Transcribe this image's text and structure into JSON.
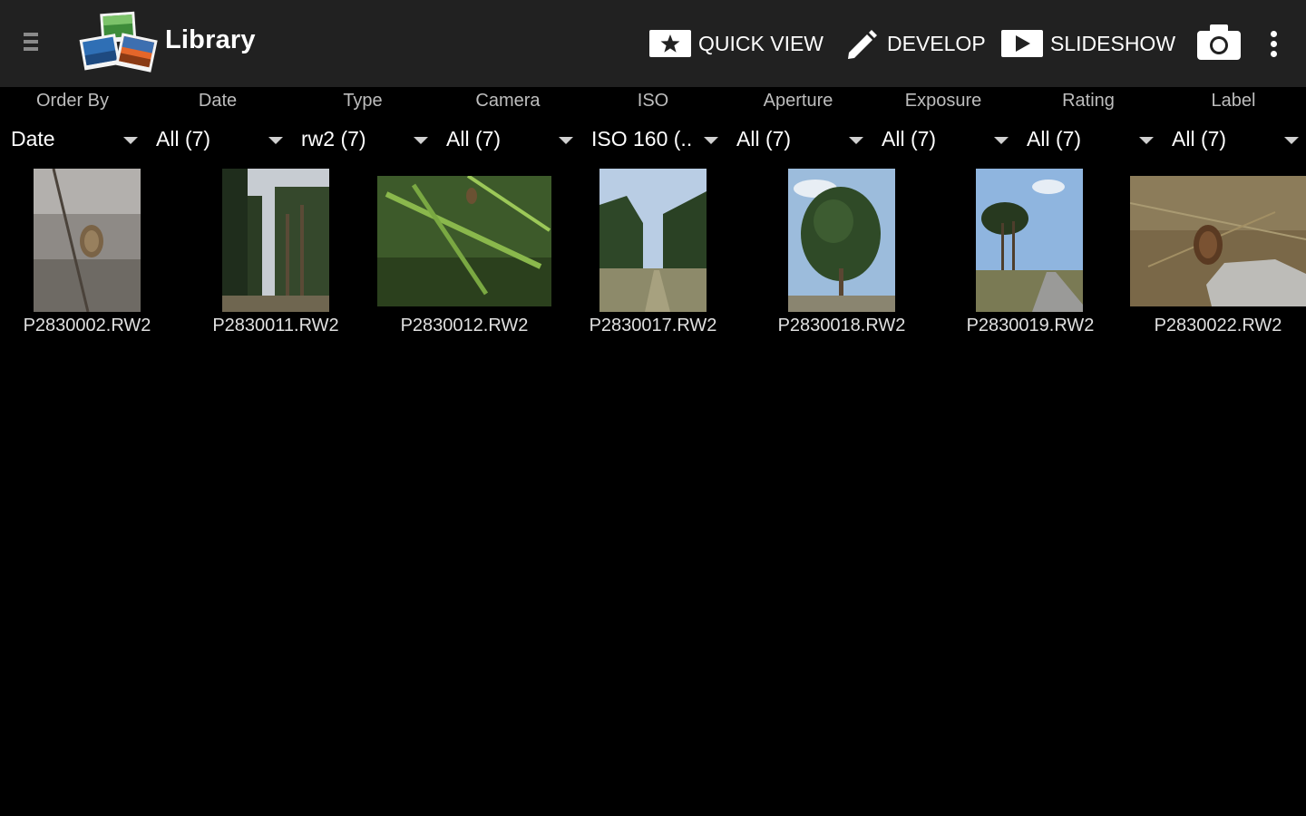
{
  "header": {
    "title": "Library",
    "actions": {
      "quick_view": "QUICK VIEW",
      "develop": "DEVELOP",
      "slideshow": "SLIDESHOW"
    }
  },
  "filters": [
    {
      "label": "Order By",
      "value": "Date"
    },
    {
      "label": "Date",
      "value": "All (7)"
    },
    {
      "label": "Type",
      "value": "rw2 (7)"
    },
    {
      "label": "Camera",
      "value": "All (7)"
    },
    {
      "label": "ISO",
      "value": "ISO 160 (.."
    },
    {
      "label": "Aperture",
      "value": "All (7)"
    },
    {
      "label": "Exposure",
      "value": "All (7)"
    },
    {
      "label": "Rating",
      "value": "All (7)"
    },
    {
      "label": "Label",
      "value": "All (7)"
    }
  ],
  "photos": [
    {
      "filename": "P2830002.RW2"
    },
    {
      "filename": "P2830011.RW2"
    },
    {
      "filename": "P2830012.RW2"
    },
    {
      "filename": "P2830017.RW2"
    },
    {
      "filename": "P2830018.RW2"
    },
    {
      "filename": "P2830019.RW2"
    },
    {
      "filename": "P2830022.RW2"
    }
  ],
  "colors": {
    "topbar": "#212121",
    "background": "#000000",
    "filter_header": "#bdbdbd"
  }
}
